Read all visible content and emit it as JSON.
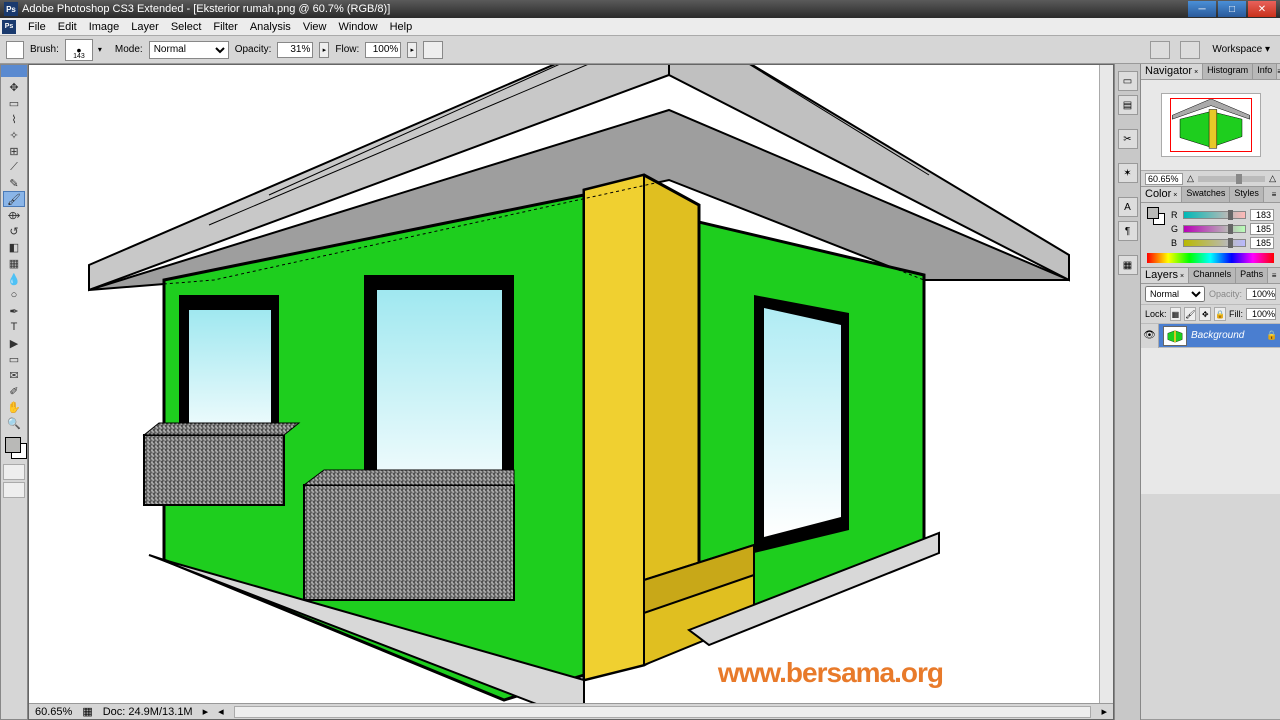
{
  "titlebar": {
    "app_icon": "Ps",
    "title": "Adobe Photoshop CS3 Extended - [Eksterior rumah.png @ 60.7% (RGB/8)]"
  },
  "menu": [
    "File",
    "Edit",
    "Image",
    "Layer",
    "Select",
    "Filter",
    "Analysis",
    "View",
    "Window",
    "Help"
  ],
  "options": {
    "brush_label": "Brush:",
    "brush_size": "143",
    "mode_label": "Mode:",
    "mode_value": "Normal",
    "opacity_label": "Opacity:",
    "opacity_value": "31%",
    "flow_label": "Flow:",
    "flow_value": "100%",
    "workspace_label": "Workspace ▾"
  },
  "tools": [
    {
      "name": "move-tool",
      "glyph": "✥"
    },
    {
      "name": "marquee-tool",
      "glyph": "▭"
    },
    {
      "name": "lasso-tool",
      "glyph": "⌇"
    },
    {
      "name": "magic-wand-tool",
      "glyph": "✧"
    },
    {
      "name": "crop-tool",
      "glyph": "⊞"
    },
    {
      "name": "slice-tool",
      "glyph": "⟋"
    },
    {
      "name": "healing-brush-tool",
      "glyph": "✎"
    },
    {
      "name": "brush-tool",
      "glyph": "🖌",
      "active": true
    },
    {
      "name": "clone-stamp-tool",
      "glyph": "⟴"
    },
    {
      "name": "history-brush-tool",
      "glyph": "↺"
    },
    {
      "name": "eraser-tool",
      "glyph": "◧"
    },
    {
      "name": "gradient-tool",
      "glyph": "▦"
    },
    {
      "name": "blur-tool",
      "glyph": "💧"
    },
    {
      "name": "dodge-tool",
      "glyph": "○"
    },
    {
      "name": "pen-tool",
      "glyph": "✒"
    },
    {
      "name": "type-tool",
      "glyph": "T"
    },
    {
      "name": "path-select-tool",
      "glyph": "▶"
    },
    {
      "name": "shape-tool",
      "glyph": "▭"
    },
    {
      "name": "notes-tool",
      "glyph": "✉"
    },
    {
      "name": "eyedropper-tool",
      "glyph": "✐"
    },
    {
      "name": "hand-tool",
      "glyph": "✋"
    },
    {
      "name": "zoom-tool",
      "glyph": "🔍"
    }
  ],
  "colors": {
    "foreground": "#b9b9b7",
    "background": "#ffffff"
  },
  "statusbar": {
    "zoom": "60.65%",
    "doc": "Doc: 24.9M/13.1M"
  },
  "navigator": {
    "tabs": [
      "Navigator",
      "Histogram",
      "Info"
    ],
    "zoom": "60.65%"
  },
  "color_panel": {
    "tabs": [
      "Color",
      "Swatches",
      "Styles"
    ],
    "r": 183,
    "g": 185,
    "b": 185
  },
  "layers_panel": {
    "tabs": [
      "Layers",
      "Channels",
      "Paths"
    ],
    "blend_mode": "Normal",
    "opacity_label": "Opacity:",
    "opacity": "100%",
    "lock_label": "Lock:",
    "fill_label": "Fill:",
    "fill": "100%",
    "layers": [
      {
        "name": "Background",
        "visible": true,
        "locked": true
      }
    ]
  },
  "watermark": "www.bersama.org"
}
